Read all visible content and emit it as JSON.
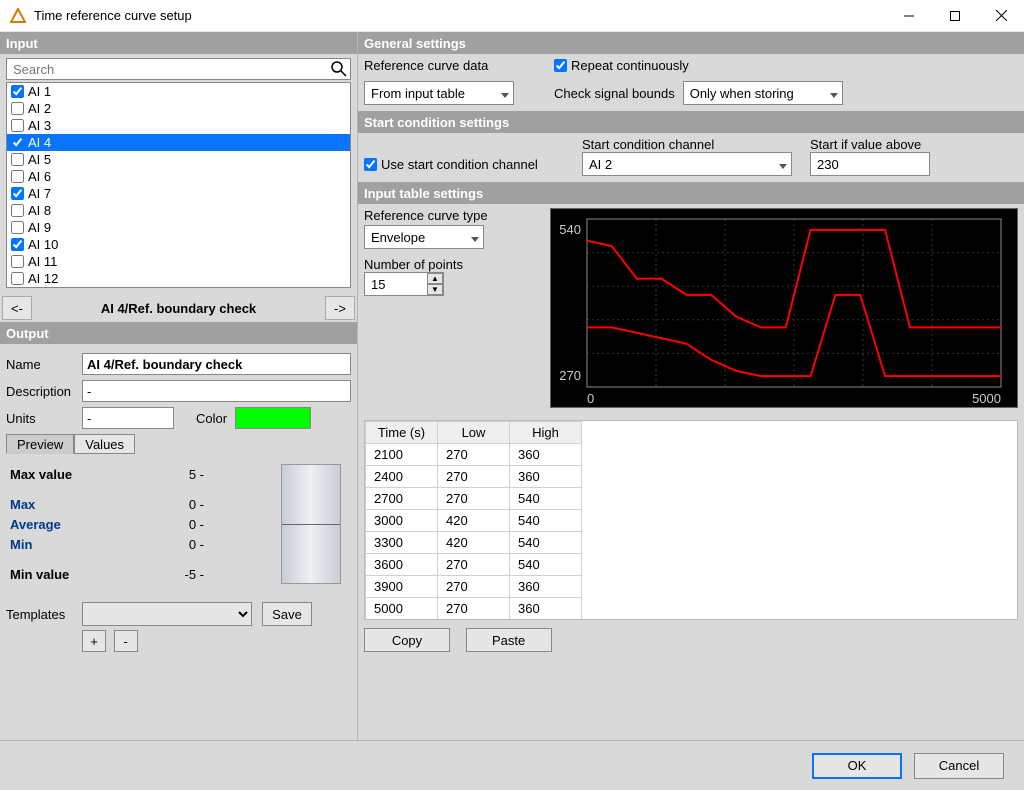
{
  "window": {
    "title": "Time reference curve setup"
  },
  "input": {
    "header": "Input",
    "search_placeholder": "Search",
    "channels": [
      {
        "name": "AI 1",
        "checked": true,
        "selected": false
      },
      {
        "name": "AI 2",
        "checked": false,
        "selected": false
      },
      {
        "name": "AI 3",
        "checked": false,
        "selected": false
      },
      {
        "name": "AI 4",
        "checked": true,
        "selected": true
      },
      {
        "name": "AI 5",
        "checked": false,
        "selected": false
      },
      {
        "name": "AI 6",
        "checked": false,
        "selected": false
      },
      {
        "name": "AI 7",
        "checked": true,
        "selected": false
      },
      {
        "name": "AI 8",
        "checked": false,
        "selected": false
      },
      {
        "name": "AI 9",
        "checked": false,
        "selected": false
      },
      {
        "name": "AI 10",
        "checked": true,
        "selected": false
      },
      {
        "name": "AI 11",
        "checked": false,
        "selected": false
      },
      {
        "name": "AI 12",
        "checked": false,
        "selected": false
      }
    ]
  },
  "nav": {
    "prev": "<-",
    "next": "->",
    "title": "AI 4/Ref. boundary check"
  },
  "output": {
    "header": "Output",
    "name_label": "Name",
    "name_value": "AI 4/Ref. boundary check",
    "desc_label": "Description",
    "desc_value": "-",
    "units_label": "Units",
    "units_value": "-",
    "color_label": "Color",
    "color_value": "#00ff00",
    "tabs": {
      "preview": "Preview",
      "values": "Values"
    },
    "preview": {
      "max_value_label": "Max value",
      "max_value": "5 -",
      "max_label": "Max",
      "max": "0 -",
      "avg_label": "Average",
      "avg": "0 -",
      "min_label": "Min",
      "min": "0 -",
      "min_value_label": "Min value",
      "min_value": "-5 -"
    },
    "templates_label": "Templates",
    "save_label": "Save",
    "plus": "+",
    "minus": "-"
  },
  "general": {
    "header": "General settings",
    "ref_curve_data_label": "Reference curve data",
    "ref_curve_data_value": "From input table",
    "repeat_label": "Repeat continuously",
    "repeat_checked": true,
    "check_bounds_label": "Check signal bounds",
    "check_bounds_value": "Only when storing"
  },
  "start_cond": {
    "header": "Start condition settings",
    "use_label": "Use start condition channel",
    "use_checked": true,
    "channel_label": "Start condition channel",
    "channel_value": "AI 2",
    "above_label": "Start if value above",
    "above_value": "230"
  },
  "input_table": {
    "header": "Input table settings",
    "ref_type_label": "Reference curve type",
    "ref_type_value": "Envelope",
    "num_points_label": "Number of points",
    "num_points_value": "15",
    "columns": [
      "Time (s)",
      "Low",
      "High"
    ],
    "rows": [
      [
        "2100",
        "270",
        "360"
      ],
      [
        "2400",
        "270",
        "360"
      ],
      [
        "2700",
        "270",
        "540"
      ],
      [
        "3000",
        "420",
        "540"
      ],
      [
        "3300",
        "420",
        "540"
      ],
      [
        "3600",
        "270",
        "540"
      ],
      [
        "3900",
        "270",
        "360"
      ],
      [
        "5000",
        "270",
        "360"
      ]
    ],
    "copy_label": "Copy",
    "paste_label": "Paste"
  },
  "chart_data": {
    "type": "line",
    "x": [
      0,
      300,
      600,
      900,
      1200,
      1500,
      1800,
      2100,
      2400,
      2700,
      3000,
      3300,
      3600,
      3900,
      5000
    ],
    "series": [
      {
        "name": "High",
        "values": [
          520,
          510,
          450,
          450,
          420,
          420,
          380,
          360,
          360,
          540,
          540,
          540,
          540,
          360,
          360
        ]
      },
      {
        "name": "Low",
        "values": [
          360,
          360,
          350,
          340,
          330,
          300,
          280,
          270,
          270,
          270,
          420,
          420,
          270,
          270,
          270
        ]
      }
    ],
    "xlabel": "",
    "ylabel": "",
    "xlim": [
      0,
      5000
    ],
    "ylim": [
      250,
      560
    ],
    "xticks": [
      "0",
      "5000"
    ],
    "yticks": [
      "270",
      "540"
    ],
    "color": "#ff0000"
  },
  "footer": {
    "ok": "OK",
    "cancel": "Cancel"
  }
}
